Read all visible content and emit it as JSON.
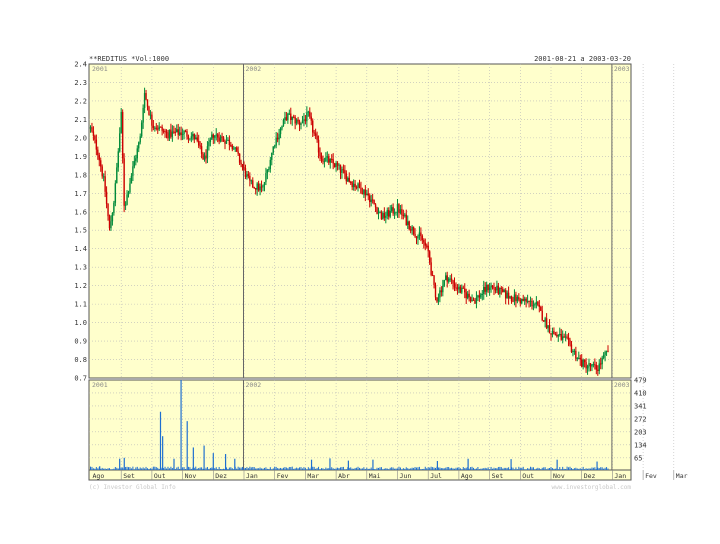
{
  "chart_data": {
    "type": "candlestick",
    "title_left": "**REDITUS *Vol:1000",
    "title_right": "2001-08-21 a 2003-03-20",
    "colors": {
      "background": "#ffffcc",
      "up": "#008a3a",
      "down": "#cc0000",
      "volume": "#1e6fd0",
      "grid": "#b8b8b8",
      "frame": "#555555",
      "year_line": "#666666"
    },
    "price": {
      "ylim": [
        0.7,
        2.4
      ],
      "yticks": [
        "2.4",
        "2.3",
        "2.2",
        "2.1",
        "2.0",
        "1.9",
        "1.8",
        "1.7",
        "1.6",
        "1.5",
        "1.4",
        "1.3",
        "1.2",
        "1.1",
        "1.0",
        "0.9",
        "0.8",
        "0.7"
      ],
      "year_markers": [
        {
          "label": "2001",
          "month_index": 0
        },
        {
          "label": "2002",
          "month_index": 5
        },
        {
          "label": "2003",
          "month_index": 17
        }
      ],
      "anchors": [
        [
          0.0,
          2.05
        ],
        [
          0.25,
          1.92
        ],
        [
          0.45,
          1.75
        ],
        [
          0.62,
          1.5
        ],
        [
          0.78,
          1.68
        ],
        [
          1.0,
          2.12
        ],
        [
          1.1,
          1.62
        ],
        [
          1.4,
          1.85
        ],
        [
          1.62,
          2.0
        ],
        [
          1.75,
          2.25
        ],
        [
          2.0,
          2.08
        ],
        [
          2.5,
          2.02
        ],
        [
          3.0,
          2.03
        ],
        [
          3.4,
          2.0
        ],
        [
          3.7,
          1.88
        ],
        [
          4.0,
          2.02
        ],
        [
          4.6,
          1.97
        ],
        [
          5.2,
          1.75
        ],
        [
          5.6,
          1.72
        ],
        [
          6.0,
          1.98
        ],
        [
          6.4,
          2.12
        ],
        [
          6.8,
          2.08
        ],
        [
          7.1,
          2.12
        ],
        [
          7.5,
          1.9
        ],
        [
          8.0,
          1.85
        ],
        [
          8.5,
          1.76
        ],
        [
          9.0,
          1.7
        ],
        [
          9.5,
          1.57
        ],
        [
          10.0,
          1.62
        ],
        [
          10.5,
          1.5
        ],
        [
          10.8,
          1.45
        ],
        [
          11.0,
          1.38
        ],
        [
          11.25,
          1.12
        ],
        [
          11.6,
          1.25
        ],
        [
          12.0,
          1.18
        ],
        [
          12.5,
          1.12
        ],
        [
          13.0,
          1.2
        ],
        [
          13.5,
          1.15
        ],
        [
          14.0,
          1.12
        ],
        [
          14.5,
          1.1
        ],
        [
          15.0,
          0.95
        ],
        [
          15.5,
          0.9
        ],
        [
          16.0,
          0.78
        ],
        [
          16.5,
          0.75
        ],
        [
          16.9,
          0.86
        ]
      ]
    },
    "volume": {
      "ylim": [
        0,
        479
      ],
      "yticks": [
        "479",
        "410",
        "341",
        "272",
        "203",
        "134",
        "65"
      ],
      "year_labels": [
        "2001",
        "2002",
        "2003"
      ],
      "spikes": [
        {
          "month": 0.3,
          "value": 20
        },
        {
          "month": 0.95,
          "value": 60
        },
        {
          "month": 1.1,
          "value": 65
        },
        {
          "month": 2.28,
          "value": 310
        },
        {
          "month": 2.35,
          "value": 180
        },
        {
          "month": 2.72,
          "value": 60
        },
        {
          "month": 2.95,
          "value": 479
        },
        {
          "month": 3.15,
          "value": 260
        },
        {
          "month": 3.35,
          "value": 120
        },
        {
          "month": 3.7,
          "value": 130
        },
        {
          "month": 4.0,
          "value": 90
        },
        {
          "month": 4.4,
          "value": 85
        },
        {
          "month": 4.7,
          "value": 60
        },
        {
          "month": 7.2,
          "value": 55
        },
        {
          "month": 7.8,
          "value": 62
        },
        {
          "month": 8.4,
          "value": 50
        },
        {
          "month": 9.2,
          "value": 55
        },
        {
          "month": 11.3,
          "value": 48
        },
        {
          "month": 12.3,
          "value": 60
        },
        {
          "month": 13.7,
          "value": 58
        },
        {
          "month": 15.2,
          "value": 55
        },
        {
          "month": 16.5,
          "value": 45
        }
      ]
    },
    "months": [
      "Ago",
      "Set",
      "Out",
      "Nov",
      "Dez",
      "Jan",
      "Fev",
      "Mar",
      "Abr",
      "Mai",
      "Jun",
      "Jul",
      "Ago",
      "Set",
      "Out",
      "Nov",
      "Dez",
      "Jan",
      "Fev",
      "Mar"
    ],
    "footer_left": "(c) Investor    Global  Info",
    "footer_right": "www.investorglobal.com",
    "grid": true
  }
}
